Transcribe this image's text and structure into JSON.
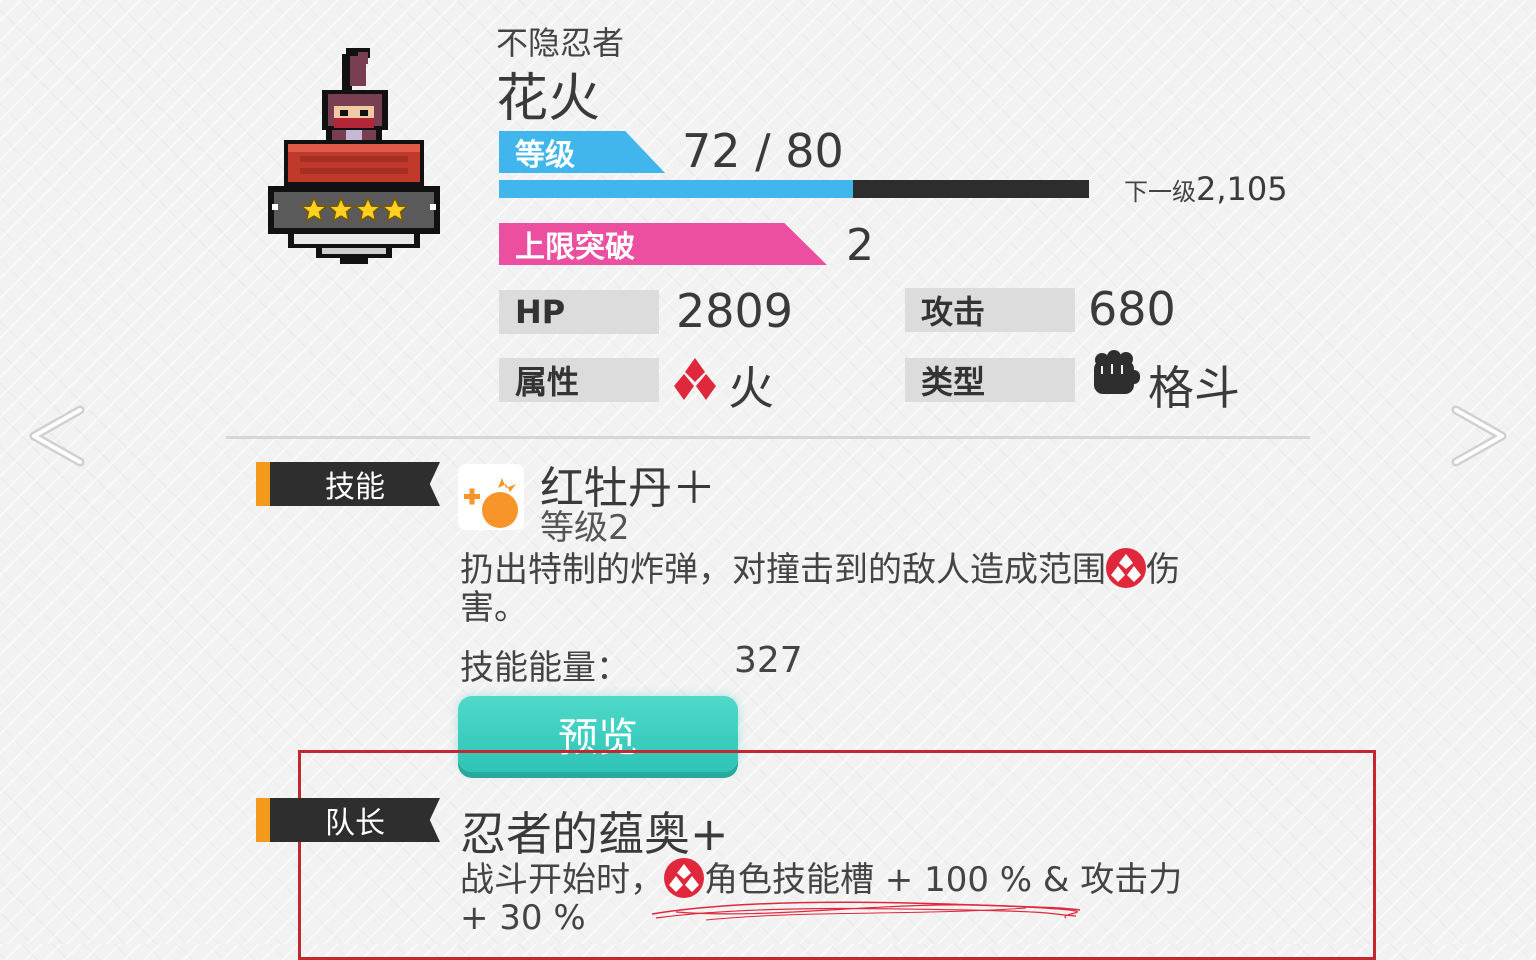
{
  "character": {
    "title": "不隐忍者",
    "name": "花火",
    "stars": 4,
    "level_label": "等级",
    "level_value": "72 / 80",
    "xp_progress": 0.6,
    "next_level_label": "下一级",
    "next_level_value": "2,105",
    "limit_break_label": "上限突破",
    "limit_break_value": "2"
  },
  "stats": {
    "hp_label": "HP",
    "hp_value": "2809",
    "attack_label": "攻击",
    "attack_value": "680",
    "attribute_label": "属性",
    "attribute_value": "火",
    "type_label": "类型",
    "type_value": "格斗"
  },
  "skill": {
    "section_label": "技能",
    "name": "红牡丹＋",
    "level": "等级2",
    "description_part1": "扔出特制的炸弹，对撞击到的敌人造成范围",
    "description_part2": "伤",
    "description_part3": "害。",
    "energy_label": "技能能量：",
    "energy_value": "327",
    "preview_button": "预览"
  },
  "leader": {
    "section_label": "队长",
    "name": "忍者的蕴奥+",
    "description_part1": "战斗开始时，",
    "description_part2": "角色技能槽 + 100 % & 攻击力",
    "description_part3": "+ 30 %"
  },
  "colors": {
    "level_tag": "#41b6ec",
    "limit_tag": "#ec4f9f",
    "fire_red": "#e0283c",
    "preview_button": "#2ec4b6",
    "highlight_box": "#c3272f",
    "section_stripe": "#f39a1c"
  },
  "icons": {
    "nav_left": "chevron-left-icon",
    "nav_right": "chevron-right-icon",
    "fire": "fire-element-icon",
    "fist": "fist-icon",
    "skill": "bomb-icon"
  }
}
